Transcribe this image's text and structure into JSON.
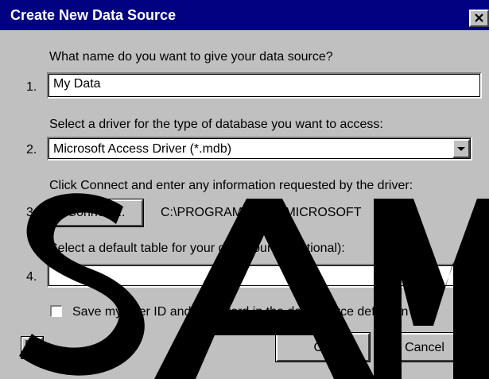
{
  "window": {
    "title": "Create New Data Source",
    "close_icon": "close-icon"
  },
  "steps": {
    "step1": {
      "prompt": "What name do you want to give your data source?",
      "number": "1.",
      "input_value": "My Data"
    },
    "step2": {
      "prompt": "Select a driver for the type of database you want to access:",
      "number": "2.",
      "selected_driver": "Microsoft Access Driver (*.mdb)"
    },
    "step3": {
      "prompt": "Click Connect and enter any information requested by the driver:",
      "number": "3.",
      "connect_label": "Connect...",
      "connection_path": "C:\\PROGRAM FILES\\MICROSOFT"
    },
    "step4": {
      "prompt": "Select a default table for your data source (optional):",
      "number": "4.",
      "selected_table": ""
    }
  },
  "save_credentials": {
    "label": "Save my user ID and password in the data source definition",
    "checked": false
  },
  "buttons": {
    "help_icon": "help-icon",
    "ok_label": "OK",
    "cancel_label": "Cancel"
  },
  "watermark": {
    "text": "SAM",
    "color": "#000000"
  },
  "colors": {
    "title_bar": "#000080",
    "dialog_face": "#c0c0c0"
  }
}
